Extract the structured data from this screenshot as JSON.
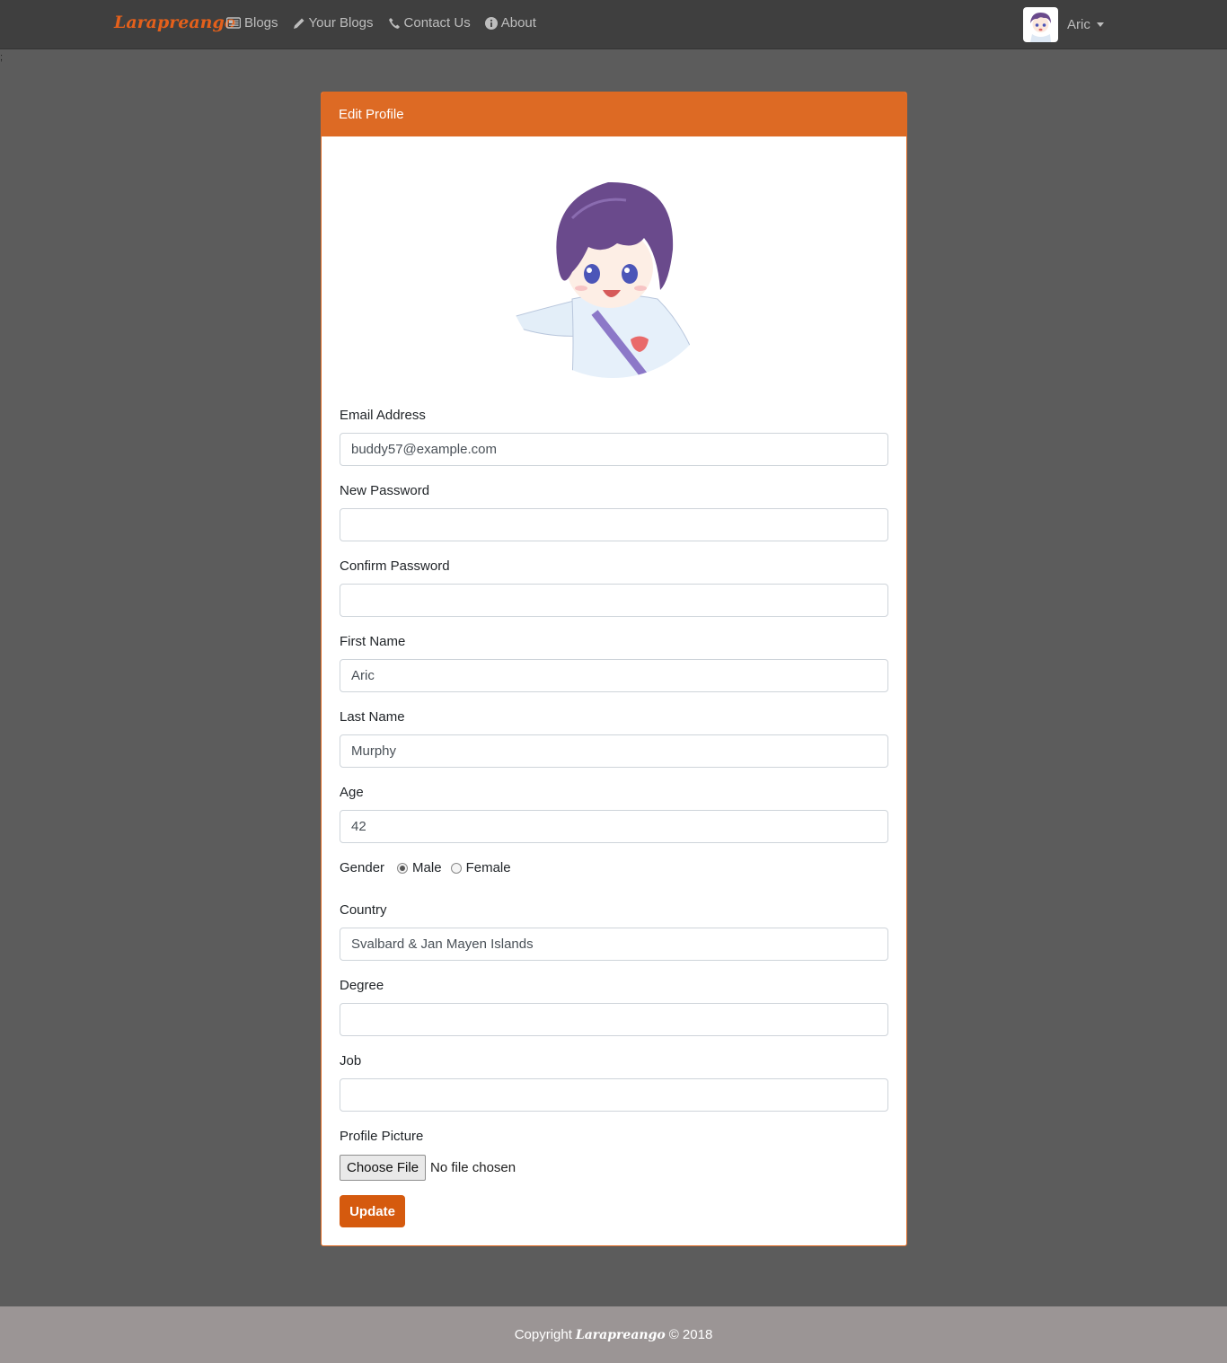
{
  "navbar": {
    "brand": "Larapreango",
    "links": [
      {
        "label": "Blogs",
        "icon": "newspaper-icon"
      },
      {
        "label": "Your Blogs",
        "icon": "pencil-icon"
      },
      {
        "label": "Contact Us",
        "icon": "phone-icon"
      },
      {
        "label": "About",
        "icon": "info-circle-icon"
      }
    ],
    "user_name": "Aric",
    "user_icon": "caret-down-icon"
  },
  "stray_text": ";",
  "card": {
    "title": "Edit Profile",
    "header_color": "#dd6a24"
  },
  "form": {
    "email": {
      "label": "Email Address",
      "value": "buddy57@example.com"
    },
    "new_password": {
      "label": "New Password",
      "value": ""
    },
    "confirm_password": {
      "label": "Confirm Password",
      "value": ""
    },
    "first_name": {
      "label": "First Name",
      "value": "Aric"
    },
    "last_name": {
      "label": "Last Name",
      "value": "Murphy"
    },
    "age": {
      "label": "Age",
      "value": "42"
    },
    "gender": {
      "label": "Gender",
      "options": [
        "Male",
        "Female"
      ],
      "selected": "Male"
    },
    "country": {
      "label": "Country",
      "value": "Svalbard & Jan Mayen Islands"
    },
    "degree": {
      "label": "Degree",
      "value": ""
    },
    "job": {
      "label": "Job",
      "value": ""
    },
    "profile_picture": {
      "label": "Profile Picture",
      "button": "Choose File",
      "status": "No file chosen"
    },
    "submit": "Update"
  },
  "footer": {
    "prefix": "Copyright",
    "brand": "Larapreango",
    "suffix": "© 2018"
  },
  "colors": {
    "accent": "#d55a0e",
    "navbar": "#3f3f3f",
    "background": "#5c5c5c",
    "footer": "#9b9595"
  }
}
